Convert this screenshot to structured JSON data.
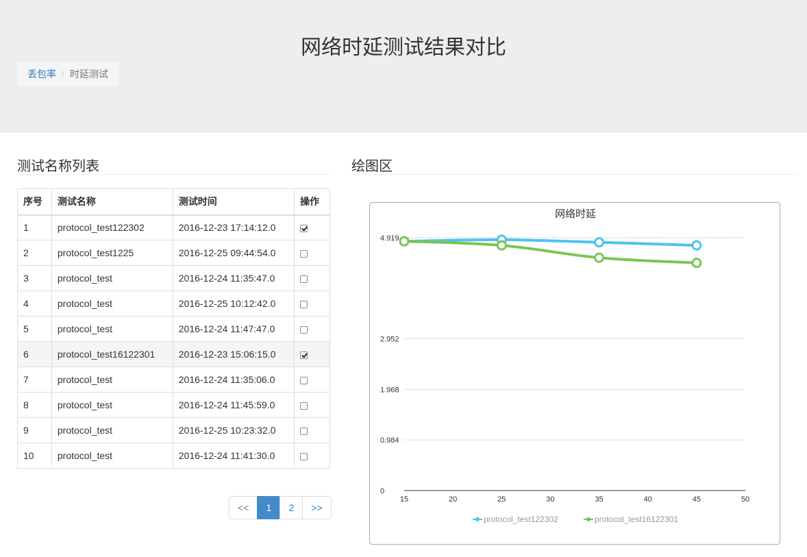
{
  "header": {
    "title": "网络时延测试结果对比",
    "breadcrumb": {
      "link": "丢包率",
      "active": "时延测试"
    }
  },
  "left": {
    "title": "测试名称列表",
    "columns": [
      "序号",
      "测试名称",
      "测试时间",
      "操作"
    ],
    "rows": [
      {
        "no": "1",
        "name": "protocol_test122302",
        "time": "2016-12-23 17:14:12.0",
        "checked": true
      },
      {
        "no": "2",
        "name": "protocol_test1225",
        "time": "2016-12-25 09:44:54.0",
        "checked": false
      },
      {
        "no": "3",
        "name": "protocol_test",
        "time": "2016-12-24 11:35:47.0",
        "checked": false
      },
      {
        "no": "4",
        "name": "protocol_test",
        "time": "2016-12-25 10:12:42.0",
        "checked": false
      },
      {
        "no": "5",
        "name": "protocol_test",
        "time": "2016-12-24 11:47:47.0",
        "checked": false
      },
      {
        "no": "6",
        "name": "protocol_test16122301",
        "time": "2016-12-23 15:06:15.0",
        "checked": true
      },
      {
        "no": "7",
        "name": "protocol_test",
        "time": "2016-12-24 11:35:06.0",
        "checked": false
      },
      {
        "no": "8",
        "name": "protocol_test",
        "time": "2016-12-24 11:45:59.0",
        "checked": false
      },
      {
        "no": "9",
        "name": "protocol_test",
        "time": "2016-12-25 10:23:32.0",
        "checked": false
      },
      {
        "no": "10",
        "name": "protocol_test",
        "time": "2016-12-24 11:41:30.0",
        "checked": false
      }
    ],
    "pagination": {
      "prev": "<<",
      "pages": [
        "1",
        "2"
      ],
      "active": "1",
      "next": ">>"
    }
  },
  "right": {
    "title": "绘图区"
  },
  "chart_data": {
    "type": "line",
    "title": "网络时延",
    "xlim": [
      15,
      50
    ],
    "xticks": [
      "15",
      "20",
      "25",
      "30",
      "35",
      "40",
      "45",
      "50"
    ],
    "ylim": [
      0,
      4.919
    ],
    "yticks": [
      "0",
      "0.984",
      "1.968",
      "2.952",
      "4.919"
    ],
    "ytick_values": [
      0,
      0.984,
      1.968,
      2.952,
      4.919
    ],
    "grid": true,
    "legend_position": "bottom",
    "series": [
      {
        "name": "protocol_test122302",
        "color": "#4dc3f1",
        "x": [
          15,
          25,
          35,
          45
        ],
        "y": [
          4.85,
          4.88,
          4.83,
          4.77
        ]
      },
      {
        "name": "protocol_test16122301",
        "color": "#7bc452",
        "x": [
          15,
          25,
          35,
          45
        ],
        "y": [
          4.85,
          4.77,
          4.53,
          4.43
        ]
      }
    ]
  }
}
